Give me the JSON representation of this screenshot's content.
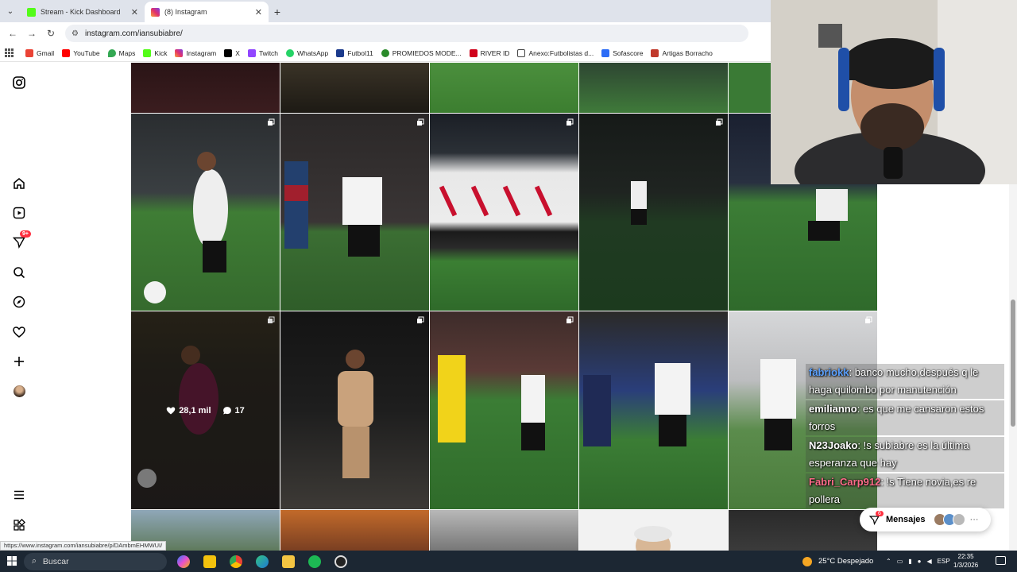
{
  "browser": {
    "tabs": [
      {
        "title": "Stream - Kick Dashboard",
        "active": false,
        "color": "#53fc18"
      },
      {
        "title": "(8) Instagram",
        "active": true,
        "color": "#e1306c"
      }
    ],
    "url": "instagram.com/iansubiabre/",
    "bookmarks": [
      {
        "label": "Gmail",
        "color": "#ea4335"
      },
      {
        "label": "YouTube",
        "color": "#ff0000"
      },
      {
        "label": "Maps",
        "color": "#34a853"
      },
      {
        "label": "Kick",
        "color": "#53fc18"
      },
      {
        "label": "Instagram",
        "color": "#e1306c"
      },
      {
        "label": "X",
        "color": "#000000"
      },
      {
        "label": "Twitch",
        "color": "#9146ff"
      },
      {
        "label": "WhatsApp",
        "color": "#25d366"
      },
      {
        "label": "Futbol11",
        "color": "#1b3a8c"
      },
      {
        "label": "PROMIEDOS MODE...",
        "color": "#2a8a2a"
      },
      {
        "label": "RIVER ID",
        "color": "#d0021b"
      },
      {
        "label": "Anexo:Futbolistas d...",
        "color": "#444444"
      },
      {
        "label": "Sofascore",
        "color": "#2c6cf6"
      },
      {
        "label": "Artigas Borracho",
        "color": "#c0392b"
      }
    ]
  },
  "rail": {
    "notifications_badge": "9+"
  },
  "grid": {
    "hover_stats": {
      "likes": "28,1 mil",
      "comments": "17"
    }
  },
  "chat": [
    {
      "user": "fabriokk",
      "text": ": banco mucho,después q le haga quilombo por manutención",
      "color": "#5aa0ff"
    },
    {
      "user": "emilianno",
      "text": ": es que me cansaron estos forros",
      "color": "#ffffff"
    },
    {
      "user": "N23Joako",
      "text": ": !s subiabre es la última esperanza que hay",
      "color": "#ffffff"
    },
    {
      "user": "Fabri_Carp912",
      "text": ": !s Tiene novia,es re pollera",
      "color": "#ff6b8a"
    }
  ],
  "messages": {
    "label": "Mensajes",
    "badge": "6"
  },
  "status_url": "https://www.instagram.com/iansubiabre/p/DAmbmEHMWUI/",
  "taskbar": {
    "search_placeholder": "Buscar",
    "weather": "25°C  Despejado",
    "language": "ESP",
    "time": "22:35",
    "date": "1/3/2026"
  }
}
